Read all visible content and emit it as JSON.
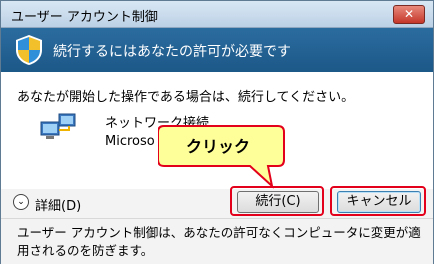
{
  "window": {
    "title": "ユーザー アカウント制御",
    "close_label": "✕"
  },
  "banner": {
    "text": "続行するにはあなたの許可が必要です",
    "icon": "shield-icon"
  },
  "main": {
    "intro": "あなたが開始した操作である場合は、続行してください。",
    "program_name": "ネットワーク接続",
    "program_publisher": "Microso",
    "program_icon": "network-connections-icon"
  },
  "buttons": {
    "details": "詳細(D)",
    "continue": "続行(C)",
    "cancel": "キャンセル"
  },
  "footer": {
    "text": "ユーザー アカウント制御は、あなたの許可なくコンピュータに変更が適用されるのを防ぎます。"
  },
  "annotation": {
    "callout": "クリック",
    "highlight_color": "#e3001b",
    "callout_fill": "#ffff99"
  }
}
